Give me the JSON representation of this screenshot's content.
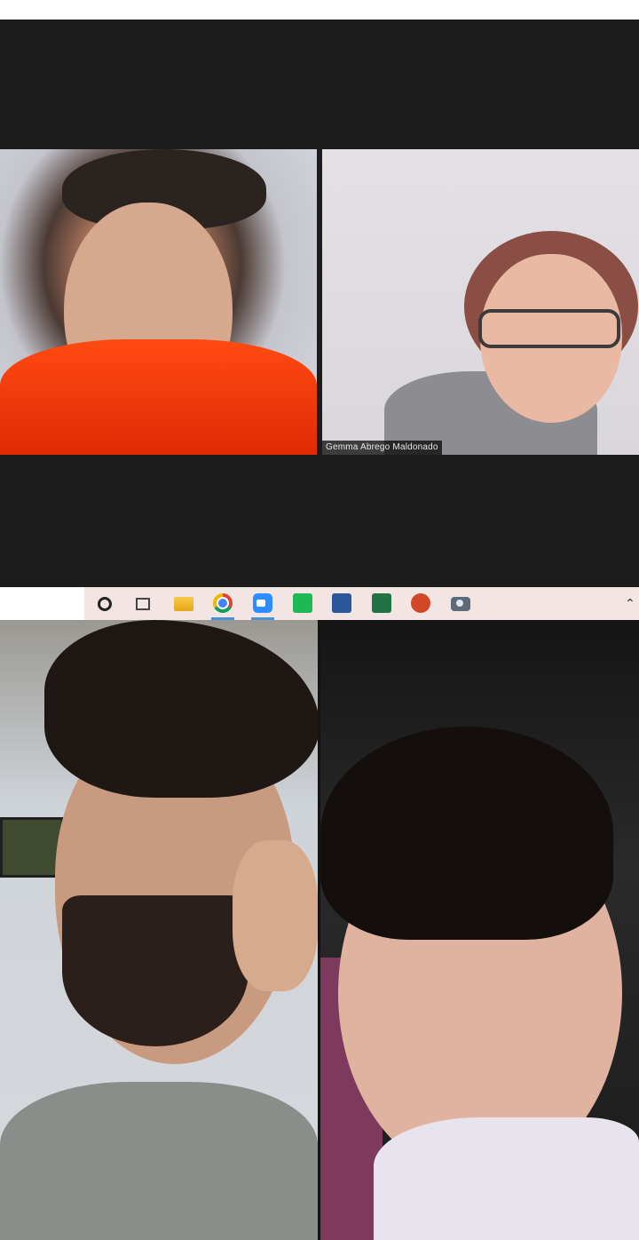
{
  "meeting": {
    "participants": [
      {
        "id": "p1",
        "name": ""
      },
      {
        "id": "p2",
        "name": "Gemma Abrego Maldonado"
      },
      {
        "id": "p3",
        "name": ""
      },
      {
        "id": "p4",
        "name": ""
      }
    ]
  },
  "taskbar": {
    "icons": [
      {
        "name": "search-circle-icon",
        "active": false
      },
      {
        "name": "task-view-icon",
        "active": false
      },
      {
        "name": "file-explorer-icon",
        "active": false
      },
      {
        "name": "chrome-icon",
        "active": true
      },
      {
        "name": "zoom-icon",
        "active": true
      },
      {
        "name": "spotify-icon",
        "active": false
      },
      {
        "name": "word-icon",
        "active": false
      },
      {
        "name": "excel-icon",
        "active": false
      },
      {
        "name": "powerpoint-icon",
        "active": false
      },
      {
        "name": "camera-icon",
        "active": false
      }
    ],
    "tray_chevron": "⌃"
  },
  "colors": {
    "background": "#1c1c1c",
    "taskbar": "#f2e5e3",
    "active_indicator": "#4a90d9"
  }
}
